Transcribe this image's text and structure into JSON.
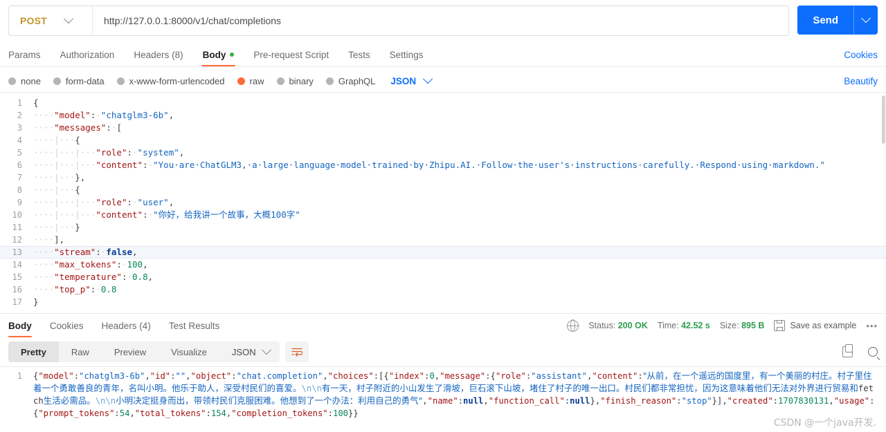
{
  "request_bar": {
    "method": "POST",
    "method_caret": "chevron-down-icon",
    "url": "http://127.0.0.1:8000/v1/chat/completions",
    "url_placeholder": "Enter request URL",
    "send_label": "Send",
    "send_caret": "chevron-down-icon"
  },
  "request_tabs": {
    "items": [
      {
        "label": "Params",
        "active": false
      },
      {
        "label": "Authorization",
        "active": false
      },
      {
        "label": "Headers (8)",
        "active": false
      },
      {
        "label": "Body",
        "active": true,
        "dot": true
      },
      {
        "label": "Pre-request Script",
        "active": false
      },
      {
        "label": "Tests",
        "active": false
      },
      {
        "label": "Settings",
        "active": false
      }
    ],
    "cookies_link": "Cookies"
  },
  "body_type": {
    "options": [
      {
        "label": "none",
        "selected": false
      },
      {
        "label": "form-data",
        "selected": false
      },
      {
        "label": "x-www-form-urlencoded",
        "selected": false
      },
      {
        "label": "raw",
        "selected": true
      },
      {
        "label": "binary",
        "selected": false
      },
      {
        "label": "GraphQL",
        "selected": false
      }
    ],
    "format": "JSON",
    "format_caret": "chevron-down-icon",
    "beautify_label": "Beautify"
  },
  "request_editor": {
    "lines": [
      {
        "n": "1",
        "highlight": false,
        "tokens": [
          {
            "t": "punc",
            "v": "{"
          }
        ]
      },
      {
        "n": "2",
        "highlight": false,
        "tokens": [
          {
            "t": "ws",
            "v": "····"
          },
          {
            "t": "key",
            "v": "\"model\""
          },
          {
            "t": "punc",
            "v": ":"
          },
          {
            "t": "ws",
            "v": "·"
          },
          {
            "t": "str",
            "v": "\"chatglm3-6b\""
          },
          {
            "t": "punc",
            "v": ","
          }
        ]
      },
      {
        "n": "3",
        "highlight": false,
        "tokens": [
          {
            "t": "ws",
            "v": "····"
          },
          {
            "t": "key",
            "v": "\"messages\""
          },
          {
            "t": "punc",
            "v": ":"
          },
          {
            "t": "ws",
            "v": "·"
          },
          {
            "t": "punc",
            "v": "["
          }
        ]
      },
      {
        "n": "4",
        "highlight": false,
        "tokens": [
          {
            "t": "ws",
            "v": "····"
          },
          {
            "t": "guide",
            "v": "|"
          },
          {
            "t": "ws",
            "v": "···"
          },
          {
            "t": "punc",
            "v": "{"
          }
        ]
      },
      {
        "n": "5",
        "highlight": false,
        "tokens": [
          {
            "t": "ws",
            "v": "····"
          },
          {
            "t": "guide",
            "v": "|"
          },
          {
            "t": "ws",
            "v": "···"
          },
          {
            "t": "guide",
            "v": "|"
          },
          {
            "t": "ws",
            "v": "···"
          },
          {
            "t": "key",
            "v": "\"role\""
          },
          {
            "t": "punc",
            "v": ":"
          },
          {
            "t": "ws",
            "v": "·"
          },
          {
            "t": "str",
            "v": "\"system\""
          },
          {
            "t": "punc",
            "v": ","
          }
        ]
      },
      {
        "n": "6",
        "highlight": false,
        "tokens": [
          {
            "t": "ws",
            "v": "····"
          },
          {
            "t": "guide",
            "v": "|"
          },
          {
            "t": "ws",
            "v": "···"
          },
          {
            "t": "guide",
            "v": "|"
          },
          {
            "t": "ws",
            "v": "···"
          },
          {
            "t": "key",
            "v": "\"content\""
          },
          {
            "t": "punc",
            "v": ":"
          },
          {
            "t": "ws",
            "v": "·"
          },
          {
            "t": "str",
            "v": "\"You·are·ChatGLM3,·a·large·language·model·trained·by·Zhipu.AI.·Follow·the·user's·instructions·carefully.·Respond·using·markdown.\""
          }
        ]
      },
      {
        "n": "7",
        "highlight": false,
        "tokens": [
          {
            "t": "ws",
            "v": "····"
          },
          {
            "t": "guide",
            "v": "|"
          },
          {
            "t": "ws",
            "v": "···"
          },
          {
            "t": "punc",
            "v": "},"
          }
        ]
      },
      {
        "n": "8",
        "highlight": false,
        "tokens": [
          {
            "t": "ws",
            "v": "····"
          },
          {
            "t": "guide",
            "v": "|"
          },
          {
            "t": "ws",
            "v": "···"
          },
          {
            "t": "punc",
            "v": "{"
          }
        ]
      },
      {
        "n": "9",
        "highlight": false,
        "tokens": [
          {
            "t": "ws",
            "v": "····"
          },
          {
            "t": "guide",
            "v": "|"
          },
          {
            "t": "ws",
            "v": "···"
          },
          {
            "t": "guide",
            "v": "|"
          },
          {
            "t": "ws",
            "v": "···"
          },
          {
            "t": "key",
            "v": "\"role\""
          },
          {
            "t": "punc",
            "v": ":"
          },
          {
            "t": "ws",
            "v": "·"
          },
          {
            "t": "str",
            "v": "\"user\""
          },
          {
            "t": "punc",
            "v": ","
          }
        ]
      },
      {
        "n": "10",
        "highlight": false,
        "tokens": [
          {
            "t": "ws",
            "v": "····"
          },
          {
            "t": "guide",
            "v": "|"
          },
          {
            "t": "ws",
            "v": "···"
          },
          {
            "t": "guide",
            "v": "|"
          },
          {
            "t": "ws",
            "v": "···"
          },
          {
            "t": "key",
            "v": "\"content\""
          },
          {
            "t": "punc",
            "v": ":"
          },
          {
            "t": "ws",
            "v": "·"
          },
          {
            "t": "str",
            "v": "\"你好，给我讲一个故事，大概100字\""
          }
        ]
      },
      {
        "n": "11",
        "highlight": false,
        "tokens": [
          {
            "t": "ws",
            "v": "····"
          },
          {
            "t": "guide",
            "v": "|"
          },
          {
            "t": "ws",
            "v": "···"
          },
          {
            "t": "punc",
            "v": "}"
          }
        ]
      },
      {
        "n": "12",
        "highlight": false,
        "tokens": [
          {
            "t": "ws",
            "v": "····"
          },
          {
            "t": "punc",
            "v": "],"
          }
        ]
      },
      {
        "n": "13",
        "highlight": true,
        "tokens": [
          {
            "t": "ws",
            "v": "····"
          },
          {
            "t": "key",
            "v": "\"stream\""
          },
          {
            "t": "punc",
            "v": ":"
          },
          {
            "t": "ws",
            "v": "·"
          },
          {
            "t": "bool",
            "v": "false"
          },
          {
            "t": "punc",
            "v": ","
          }
        ]
      },
      {
        "n": "14",
        "highlight": false,
        "tokens": [
          {
            "t": "ws",
            "v": "····"
          },
          {
            "t": "key",
            "v": "\"max_tokens\""
          },
          {
            "t": "punc",
            "v": ":"
          },
          {
            "t": "ws",
            "v": "·"
          },
          {
            "t": "num",
            "v": "100"
          },
          {
            "t": "punc",
            "v": ","
          }
        ]
      },
      {
        "n": "15",
        "highlight": false,
        "tokens": [
          {
            "t": "ws",
            "v": "····"
          },
          {
            "t": "key",
            "v": "\"temperature\""
          },
          {
            "t": "punc",
            "v": ":"
          },
          {
            "t": "ws",
            "v": "·"
          },
          {
            "t": "num",
            "v": "0.8"
          },
          {
            "t": "punc",
            "v": ","
          }
        ]
      },
      {
        "n": "16",
        "highlight": false,
        "tokens": [
          {
            "t": "ws",
            "v": "····"
          },
          {
            "t": "key",
            "v": "\"top_p\""
          },
          {
            "t": "punc",
            "v": ":"
          },
          {
            "t": "ws",
            "v": "·"
          },
          {
            "t": "num",
            "v": "0.8"
          }
        ]
      },
      {
        "n": "17",
        "highlight": false,
        "tokens": [
          {
            "t": "punc",
            "v": "}"
          }
        ]
      }
    ]
  },
  "response_tabs": {
    "items": [
      {
        "label": "Body",
        "active": true
      },
      {
        "label": "Cookies",
        "active": false
      },
      {
        "label": "Headers (4)",
        "active": false
      },
      {
        "label": "Test Results",
        "active": false
      }
    ]
  },
  "response_meta": {
    "globe_icon": "globe-icon",
    "status_label": "Status:",
    "status_value": "200 OK",
    "time_label": "Time:",
    "time_value": "42.52 s",
    "size_label": "Size:",
    "size_value": "895 B",
    "save_icon": "save-icon",
    "save_label": "Save as example",
    "more_label": "•••"
  },
  "response_toolbar": {
    "views": [
      {
        "label": "Pretty",
        "active": true
      },
      {
        "label": "Raw",
        "active": false
      },
      {
        "label": "Preview",
        "active": false
      },
      {
        "label": "Visualize",
        "active": false
      }
    ],
    "format": "JSON",
    "format_caret": "chevron-down-icon",
    "wrap_icon": "wrap-lines-icon",
    "copy_icon": "copy-icon",
    "search_icon": "search-icon"
  },
  "response_body": {
    "line_number": "1",
    "tokens": [
      {
        "t": "punc",
        "v": "{"
      },
      {
        "t": "key",
        "v": "\"model\""
      },
      {
        "t": "punc",
        "v": ":"
      },
      {
        "t": "str",
        "v": "\"chatglm3-6b\""
      },
      {
        "t": "punc",
        "v": ","
      },
      {
        "t": "key",
        "v": "\"id\""
      },
      {
        "t": "punc",
        "v": ":"
      },
      {
        "t": "str",
        "v": "\"\""
      },
      {
        "t": "punc",
        "v": ","
      },
      {
        "t": "key",
        "v": "\"object\""
      },
      {
        "t": "punc",
        "v": ":"
      },
      {
        "t": "str",
        "v": "\"chat.completion\""
      },
      {
        "t": "punc",
        "v": ","
      },
      {
        "t": "key",
        "v": "\"choices\""
      },
      {
        "t": "punc",
        "v": ":[{"
      },
      {
        "t": "key",
        "v": "\"index\""
      },
      {
        "t": "punc",
        "v": ":"
      },
      {
        "t": "num",
        "v": "0"
      },
      {
        "t": "punc",
        "v": ","
      },
      {
        "t": "key",
        "v": "\"message\""
      },
      {
        "t": "punc",
        "v": ":{"
      },
      {
        "t": "key",
        "v": "\"role\""
      },
      {
        "t": "punc",
        "v": ":"
      },
      {
        "t": "str",
        "v": "\"assistant\""
      },
      {
        "t": "punc",
        "v": ","
      },
      {
        "t": "key",
        "v": "\"content\""
      },
      {
        "t": "punc",
        "v": ":"
      },
      {
        "t": "str-zh",
        "v": "\"从前，在一个遥远的国度里，有一个美丽的村庄。村子里住着一个勇敢善良的青年，名叫小明。他乐于助人，深受村民们的喜爱。"
      },
      {
        "t": "esc",
        "v": "\\n\\n"
      },
      {
        "t": "str-zh",
        "v": "有一天，村子附近的小山发生了滑坡，巨石滚下山坡，堵住了村子的唯一出口。村民们都非常担忧，因为这意味着他们无法对外界进行贸易和"
      },
      {
        "t": "mono",
        "v": "fetch"
      },
      {
        "t": "str-zh",
        "v": "生活必需品。"
      },
      {
        "t": "esc",
        "v": "\\n\\n"
      },
      {
        "t": "str-zh",
        "v": "小明决定挺身而出，带领村民们克服困难。他想到了一个办法：利用自己的勇气\""
      },
      {
        "t": "punc",
        "v": ","
      },
      {
        "t": "key",
        "v": "\"name\""
      },
      {
        "t": "punc",
        "v": ":"
      },
      {
        "t": "bool",
        "v": "null"
      },
      {
        "t": "punc",
        "v": ","
      },
      {
        "t": "key",
        "v": "\"function_call\""
      },
      {
        "t": "punc",
        "v": ":"
      },
      {
        "t": "bool",
        "v": "null"
      },
      {
        "t": "punc",
        "v": "},"
      },
      {
        "t": "key",
        "v": "\"finish_reason\""
      },
      {
        "t": "punc",
        "v": ":"
      },
      {
        "t": "str",
        "v": "\"stop\""
      },
      {
        "t": "punc",
        "v": "}],"
      },
      {
        "t": "key",
        "v": "\"created\""
      },
      {
        "t": "punc",
        "v": ":"
      },
      {
        "t": "num",
        "v": "1707830131"
      },
      {
        "t": "punc",
        "v": ","
      },
      {
        "t": "key",
        "v": "\"usage\""
      },
      {
        "t": "punc",
        "v": ":{"
      },
      {
        "t": "key",
        "v": "\"prompt_tokens\""
      },
      {
        "t": "punc",
        "v": ":"
      },
      {
        "t": "num",
        "v": "54"
      },
      {
        "t": "punc",
        "v": ","
      },
      {
        "t": "key",
        "v": "\"total_tokens\""
      },
      {
        "t": "punc",
        "v": ":"
      },
      {
        "t": "num",
        "v": "154"
      },
      {
        "t": "punc",
        "v": ","
      },
      {
        "t": "key",
        "v": "\"completion_tokens\""
      },
      {
        "t": "punc",
        "v": ":"
      },
      {
        "t": "num",
        "v": "100"
      },
      {
        "t": "punc",
        "v": "}}"
      }
    ]
  },
  "watermark": "CSDN @一个java开发."
}
